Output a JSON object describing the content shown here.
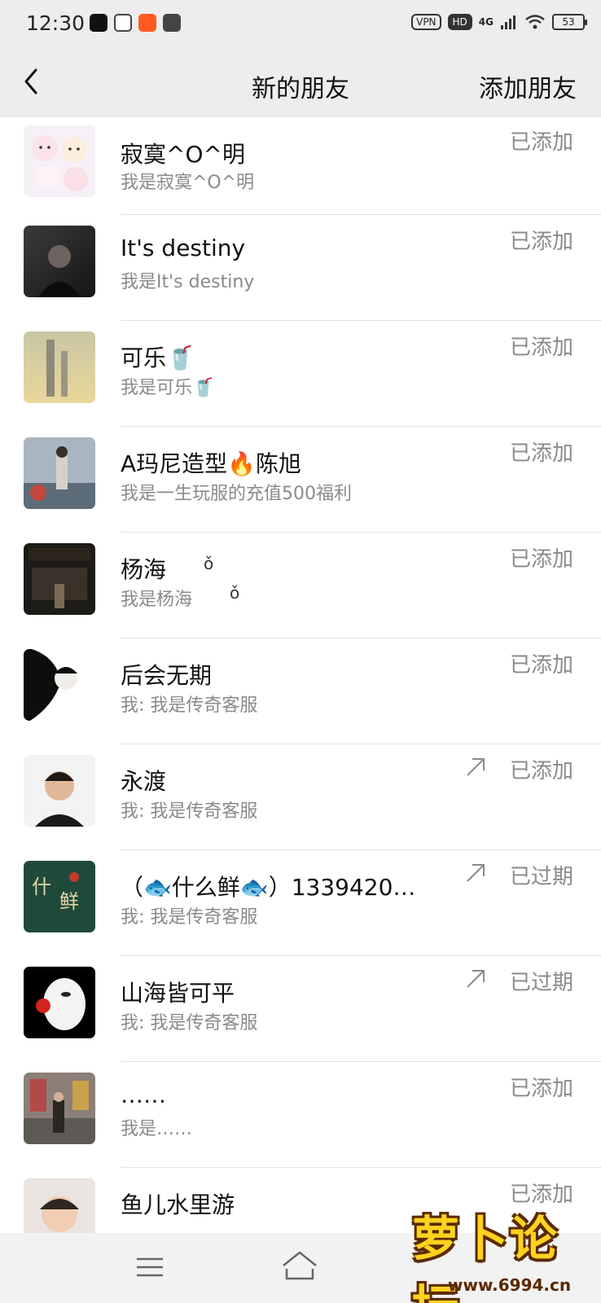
{
  "status_bar": {
    "time": "12:30",
    "vpn": "VPN",
    "hd": "HD",
    "network": "4G",
    "battery": "53"
  },
  "nav": {
    "title": "新的朋友",
    "action": "添加朋友"
  },
  "friends": [
    {
      "name": "寂寞^O^明",
      "message": "我是寂寞^O^明",
      "status": "已添加",
      "forwarded": false
    },
    {
      "name": "It's destiny",
      "message": "我是It's destiny",
      "status": "已添加",
      "forwarded": false
    },
    {
      "name": "可乐🥤",
      "message": "我是可乐🥤",
      "status": "已添加",
      "forwarded": false
    },
    {
      "name": "A玛尼造型🔥陈旭",
      "message": "我是一生玩服的充值500福利",
      "status": "已添加",
      "forwarded": false
    },
    {
      "name": "杨海",
      "message": "我是杨海",
      "status": "已添加",
      "forwarded": false
    },
    {
      "name": "后会无期",
      "message": "我: 我是传奇客服",
      "status": "已添加",
      "forwarded": false
    },
    {
      "name": "永渡",
      "message": "我: 我是传奇客服",
      "status": "已添加",
      "forwarded": true
    },
    {
      "name": "（🐟什么鲜🐟）1339420…",
      "message": "我: 我是传奇客服",
      "status": "已过期",
      "forwarded": true
    },
    {
      "name": "山海皆可平",
      "message": "我: 我是传奇客服",
      "status": "已过期",
      "forwarded": true
    },
    {
      "name": "……",
      "message": "我是……",
      "status": "已添加",
      "forwarded": false
    },
    {
      "name": "鱼儿水里游",
      "message": "",
      "status": "已添加",
      "forwarded": false
    }
  ],
  "colors": {
    "header_bg": "#ededed",
    "secondary_text": "#8a8a8a",
    "divider": "#e3e3e3"
  },
  "watermark": {
    "text": "萝卜论坛",
    "url": "www.6994.cn"
  }
}
